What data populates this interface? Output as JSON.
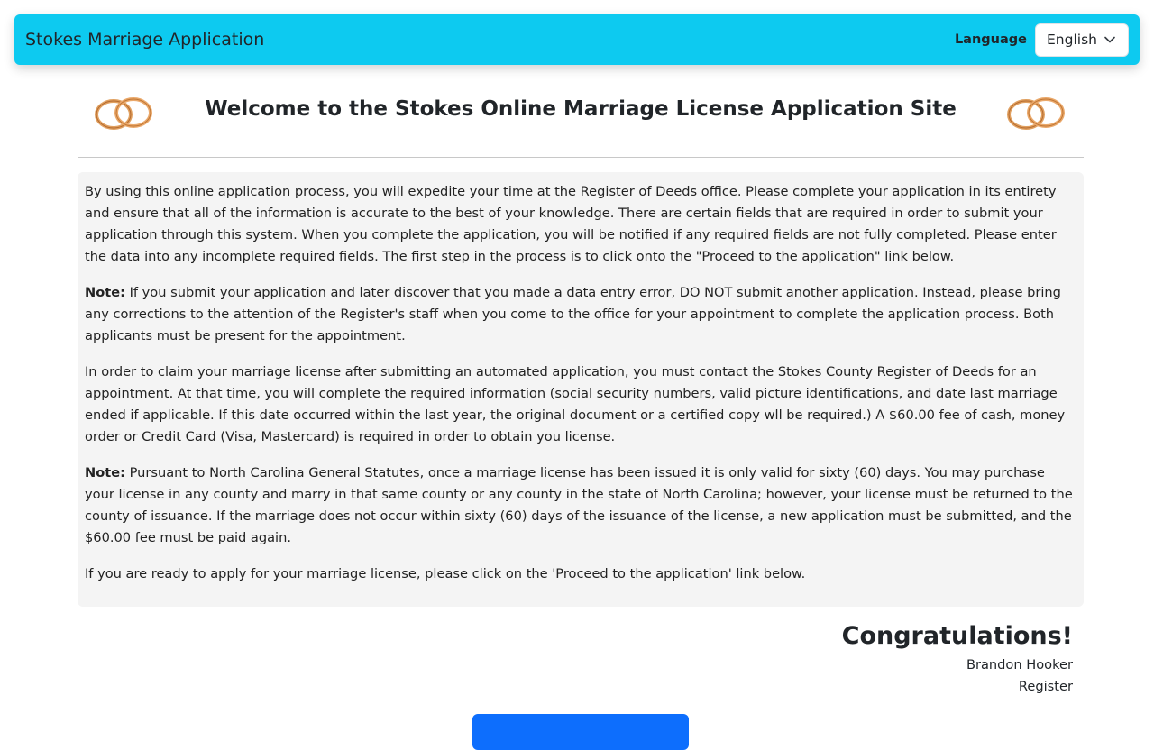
{
  "navbar": {
    "brand": "Stokes Marriage Application",
    "language_label": "Language",
    "language_selected": "English"
  },
  "header": {
    "title": "Welcome to the Stokes Online Marriage License Application Site"
  },
  "info": {
    "p1": "By using this online application process, you will expedite your time at the Register of Deeds office. Please complete your application in its entirety and ensure that all of the information is accurate to the best of your knowledge. There are certain fields that are required in order to submit your application through this system. When you complete the application, you will be notified if any required fields are not fully completed. Please enter the data into any incomplete required fields. The first step in the process is to click onto the \"Proceed to the application\" link below.",
    "note_label": "Note:",
    "p2": " If you submit your application and later discover that you made a data entry error, DO NOT submit another application. Instead, please bring any corrections to the attention of the Register's staff when you come to the office for your appointment to complete the application process. Both applicants must be present for the appointment.",
    "p3": "In order to claim your marriage license after submitting an automated application, you must contact the Stokes County Register of Deeds for an appointment. At that time, you will complete the required information (social security numbers, valid picture identifications, and date last marriage ended if applicable. If this date occurred within the last year, the original document or a certified copy wll be required.) A $60.00 fee of cash, money order or Credit Card (Visa, Mastercard) is required in order to obtain you license.",
    "p4": " Pursuant to North Carolina General Statutes, once a marriage license has been issued it is only valid for sixty (60) days. You may purchase your license in any county and marry in that same county or any county in the state of North Carolina; however, your license must be returned to the county of issuance. If the marriage does not occur within sixty (60) days of the issuance of the license, a new application must be submitted, and the $60.00 fee must be paid again.",
    "p5": "If you are ready to apply for your marriage license, please click on the 'Proceed to the application' link below."
  },
  "congrats": {
    "heading": "Congratulations!",
    "name": "Brandon Hooker",
    "role": "Register"
  },
  "colors": {
    "navbar": "#0dcaf0",
    "panel": "#f4f4f4",
    "button": "#0d6efd",
    "ring": "#d98a4a"
  },
  "icons": {
    "rings": "wedding-rings-icon",
    "dropdown": "chevron-down-icon"
  }
}
